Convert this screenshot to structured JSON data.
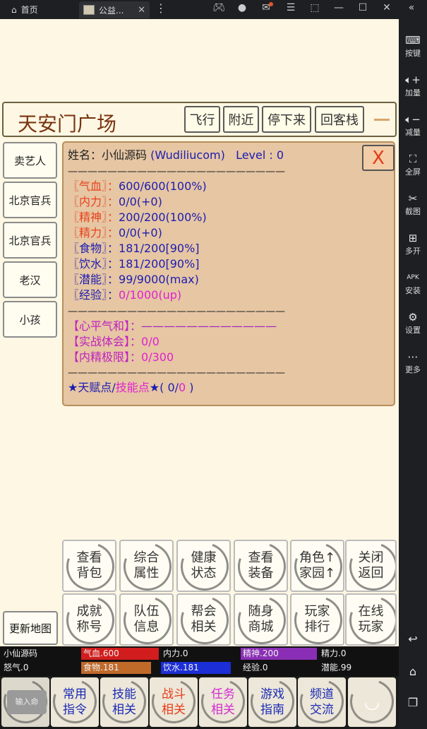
{
  "titlebar": {
    "home_label": "首页",
    "tab_label": "公益..."
  },
  "sidepanel": {
    "items": [
      {
        "label": "按键",
        "icon": "keyboard-icon"
      },
      {
        "label": "加量",
        "icon": "volume-up-icon"
      },
      {
        "label": "减量",
        "icon": "volume-down-icon"
      },
      {
        "label": "全屏",
        "icon": "fullscreen-icon"
      },
      {
        "label": "截图",
        "icon": "scissors-icon"
      },
      {
        "label": "多开",
        "icon": "multi-instance-icon"
      },
      {
        "label": "安装",
        "icon": "apk-icon"
      },
      {
        "label": "设置",
        "icon": "gear-icon"
      },
      {
        "label": "更多",
        "icon": "more-icon"
      }
    ],
    "apk_text": "APK"
  },
  "location": {
    "title": "天安门广场",
    "buttons": [
      "飞行",
      "附近",
      "停下来",
      "回客栈"
    ]
  },
  "npcs": [
    "卖艺人",
    "北京官兵",
    "北京官兵",
    "老汉",
    "小孩"
  ],
  "update_map": "更新地图",
  "character": {
    "name_label": "姓名：",
    "name": "小仙源码",
    "account": "(Wudiliucom)",
    "level": "Level : 0",
    "close": "X",
    "separator": "——————————————————————",
    "stats": [
      {
        "label": "〖气血〗",
        "colon": "：",
        "value": "600/600(100%)",
        "lc": "lbl-red",
        "vc": "val-blue"
      },
      {
        "label": "〖内力〗",
        "colon": "：",
        "value": "0/0(+0)",
        "lc": "lbl-red",
        "vc": "val-blue"
      },
      {
        "label": "〖精神〗",
        "colon": "：",
        "value": "200/200(100%)",
        "lc": "lbl-red",
        "vc": "val-blue"
      },
      {
        "label": "〖精力〗",
        "colon": "：",
        "value": "0/0(+0)",
        "lc": "lbl-red",
        "vc": "val-blue"
      },
      {
        "label": "〖食物〗",
        "colon": "：",
        "value": "181/200[90%]",
        "lc": "lbl-blue",
        "vc": "val-blue"
      },
      {
        "label": "〖饮水〗",
        "colon": "：",
        "value": "181/200[90%]",
        "lc": "lbl-blue",
        "vc": "val-blue"
      },
      {
        "label": "〖潜能〗",
        "colon": "：",
        "value": "99/9000(max)",
        "lc": "lbl-blue",
        "vc": "val-blue"
      },
      {
        "label": "〖经验〗",
        "colon": "：",
        "value": "0/1000(up)",
        "lc": "lbl-blue",
        "vc": "val-magenta"
      }
    ],
    "extra": [
      {
        "label": "【心平气和】",
        "colon": "：",
        "value": "————————————",
        "vc": "val-purple"
      },
      {
        "label": "【实战体会】",
        "colon": "：",
        "value": "0/0",
        "vc": "val-magenta"
      },
      {
        "label": "【内精极限】",
        "colon": "：",
        "value": "0/300",
        "vc": "val-magenta"
      }
    ],
    "talent": {
      "star1": "★天赋点",
      "slash": "/",
      "skill": "技能点",
      "star2": "★",
      "open": "( ",
      "v1": "0",
      "sep": "/",
      "v2": "0",
      "close": " )"
    }
  },
  "actions_row1": [
    {
      "line1": "查看",
      "line2": "背包"
    },
    {
      "line1": "综合",
      "line2": "属性"
    },
    {
      "line1": "健康",
      "line2": "状态"
    },
    {
      "line1": "查看",
      "line2": "装备"
    },
    {
      "line1": "角色↑",
      "line2": "家园↑"
    },
    {
      "line1": "关闭",
      "line2": "返回"
    }
  ],
  "actions_row2": [
    {
      "line1": "成就",
      "line2": "称号"
    },
    {
      "line1": "队伍",
      "line2": "信息"
    },
    {
      "line1": "帮会",
      "line2": "相关"
    },
    {
      "line1": "随身",
      "line2": "商城"
    },
    {
      "line1": "玩家",
      "line2": "排行"
    },
    {
      "line1": "在线",
      "line2": "玩家"
    }
  ],
  "status": {
    "name": "小仙源码",
    "anger": "怒气.0",
    "hp": "气血.600",
    "neili": "内力.0",
    "jingshen": "精神.200",
    "jingli": "精力.0",
    "food": "食物.181",
    "water": "饮水.181",
    "exp": "经验.0",
    "potential": "潜能.99",
    "levels": {
      "hp": 1.0,
      "jingshen": 1.0,
      "food": 0.9,
      "water": 0.9
    }
  },
  "bottom_nav": {
    "input_label": "输入命",
    "items": [
      {
        "line1": "常用",
        "line2": "指令",
        "color": "#1a2ab5"
      },
      {
        "line1": "技能",
        "line2": "相关",
        "color": "#1a2ab5"
      },
      {
        "line1": "战斗",
        "line2": "相关",
        "color": "#e83a1a"
      },
      {
        "line1": "任务",
        "line2": "相关",
        "color": "#d52ad0"
      },
      {
        "line1": "游戏",
        "line2": "指南",
        "color": "#1a2ab5"
      },
      {
        "line1": "频道",
        "line2": "交流",
        "color": "#1a2ab5"
      }
    ]
  }
}
